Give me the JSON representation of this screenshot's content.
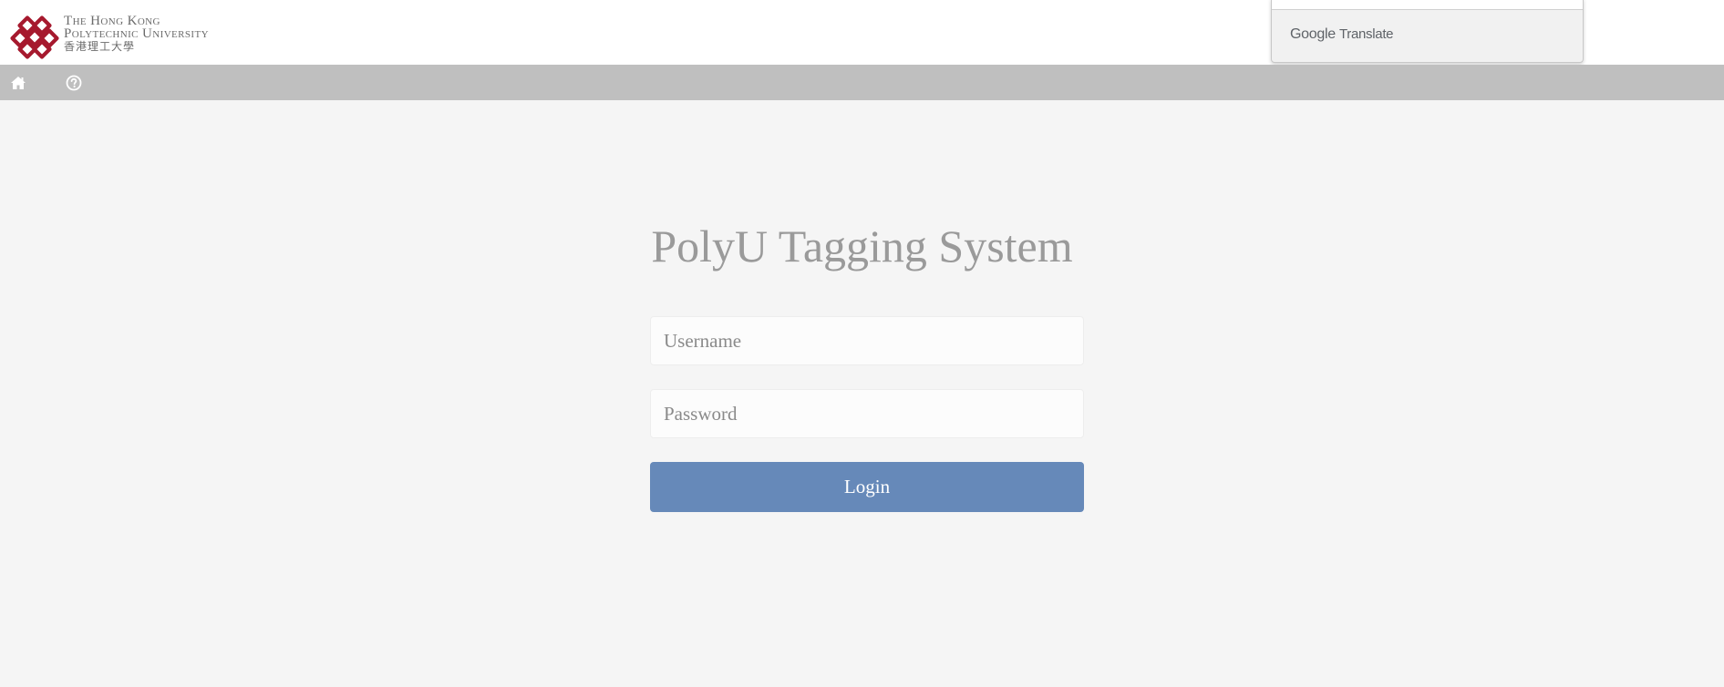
{
  "header": {
    "logo": {
      "line1": "The Hong Kong",
      "line2": "Polytechnic University",
      "line3": "香港理工大學",
      "mark_color": "#a6192e"
    }
  },
  "translate_widget": {
    "brand_google": "Google",
    "brand_translate": "Translate"
  },
  "navbar": {
    "items": [
      {
        "icon": "home-icon"
      },
      {
        "icon": "help-icon"
      }
    ],
    "background": "#bfbfbf"
  },
  "login": {
    "title": "PolyU Tagging System",
    "username_placeholder": "Username",
    "username_value": "",
    "password_placeholder": "Password",
    "password_value": "",
    "button_label": "Login",
    "button_color": "#6689b9"
  }
}
